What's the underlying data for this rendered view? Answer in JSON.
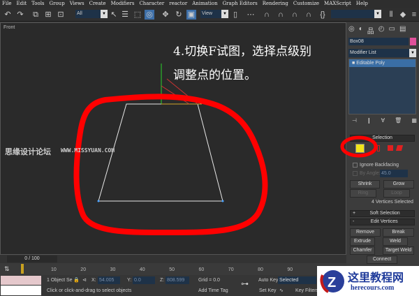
{
  "menu": [
    "File",
    "Edit",
    "Tools",
    "Group",
    "Views",
    "Create",
    "Modifiers",
    "Character",
    "reactor",
    "Animation",
    "Graph Editors",
    "Rendering",
    "Customize",
    "MAXScript",
    "Help"
  ],
  "toolbar": {
    "filter": "All",
    "coord_system": "View"
  },
  "viewport": {
    "label": "Front",
    "annotation_line1": "4.切换F试图，选择点级别",
    "annotation_line2": "调整点的位置。",
    "watermark_cn": "思缘设计论坛",
    "watermark_url": "WWW.MISSYUAN.COM",
    "highlight_color": "#ff0000"
  },
  "panel": {
    "object_name": "Box08",
    "object_color": "#e0509a",
    "modifier_list": "Modifier List",
    "stack_item": "Editable Poly",
    "selection_rollout": "Selection",
    "ignore_backfacing": "Ignore Backfacing",
    "by_angle": "By Angle:",
    "by_angle_value": "45.0",
    "shrink": "Shrink",
    "grow": "Grow",
    "ring": "Ring",
    "loop": "Loop",
    "selected_count": "4 Vertices Selected",
    "soft_selection": "Soft Selection",
    "soft_sign": "+",
    "edit_vertices": "Edit Vertices",
    "edit_sign": "-",
    "remove": "Remove",
    "break": "Break",
    "extrude": "Extrude",
    "weld": "Weld",
    "chamfer": "Chamfer",
    "target_weld": "Target Weld",
    "connect": "Connect"
  },
  "timeline": {
    "frame": "0 / 100",
    "ticks": [
      "10",
      "20",
      "30",
      "40",
      "50",
      "60",
      "70",
      "80",
      "90"
    ]
  },
  "status": {
    "objects": "1 Object Se",
    "x_label": "X:",
    "x": "54.005",
    "y_label": "Y:",
    "y": "0.0",
    "z_label": "Z:",
    "z": "808.599",
    "grid": "Grid = 0.0",
    "prompt": "Click or click-and-drag to select objects",
    "time_tag": "Add Time Tag",
    "auto_key": "Auto Key",
    "key_mode": "Selected",
    "set_key": "Set Key",
    "key_filters": "Key Filters"
  },
  "logo": {
    "title": "这里教程网",
    "url": "herecours.com"
  }
}
